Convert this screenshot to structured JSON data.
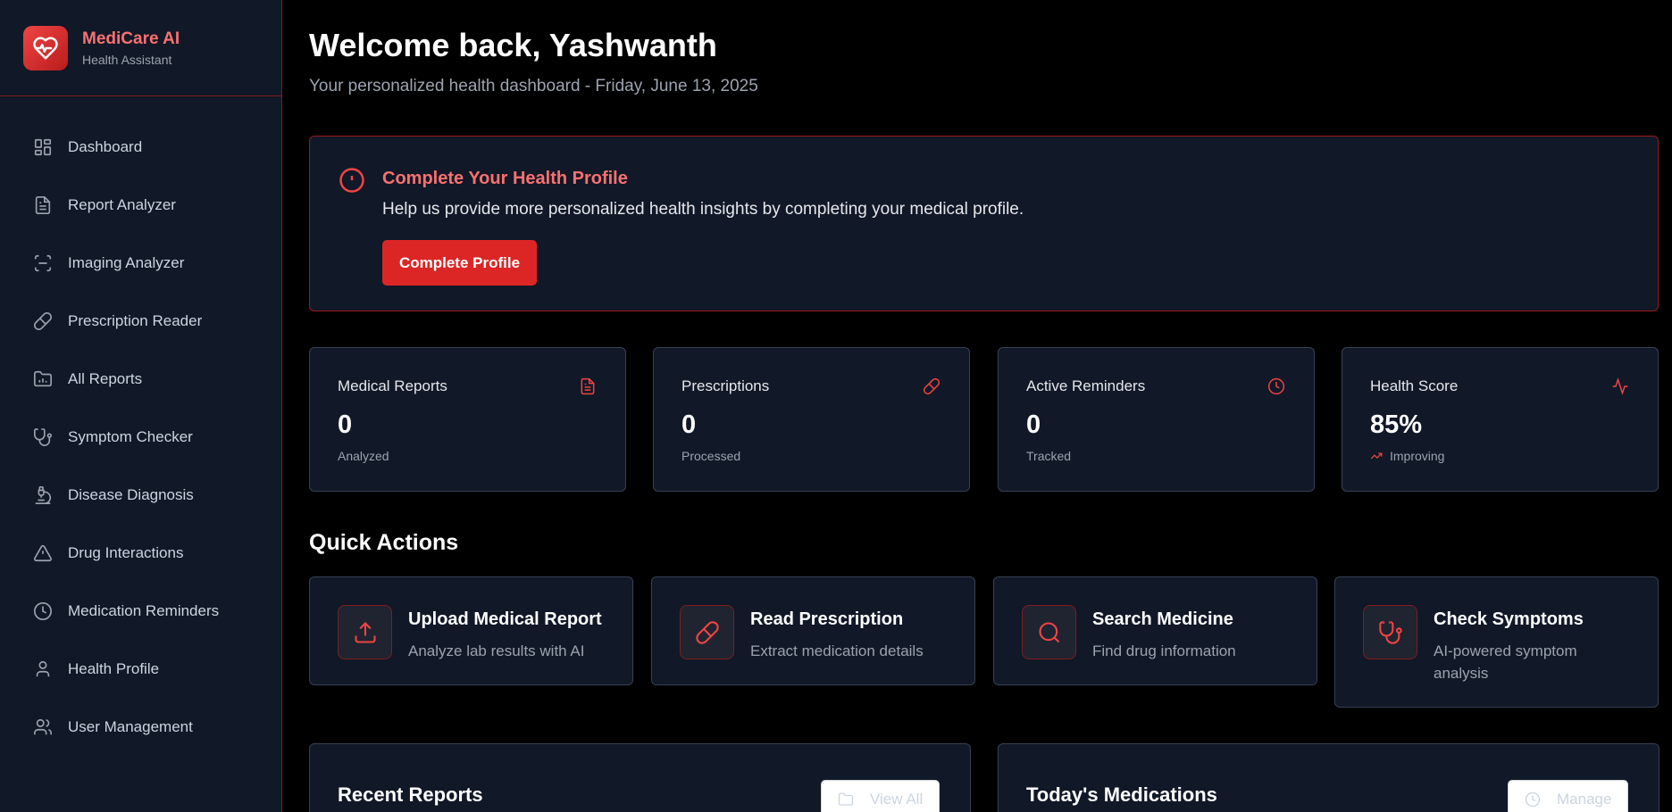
{
  "brand": {
    "name": "MediCare AI",
    "subtitle": "Health Assistant"
  },
  "sidebar": {
    "items": [
      {
        "label": "Dashboard",
        "icon": "grid-icon"
      },
      {
        "label": "Report Analyzer",
        "icon": "file-text-icon"
      },
      {
        "label": "Imaging Analyzer",
        "icon": "scan-icon"
      },
      {
        "label": "Prescription Reader",
        "icon": "pill-icon"
      },
      {
        "label": "All Reports",
        "icon": "folder-chart-icon"
      },
      {
        "label": "Symptom Checker",
        "icon": "stethoscope-icon"
      },
      {
        "label": "Disease Diagnosis",
        "icon": "microscope-icon"
      },
      {
        "label": "Drug Interactions",
        "icon": "warning-icon"
      },
      {
        "label": "Medication Reminders",
        "icon": "clock-icon"
      },
      {
        "label": "Health Profile",
        "icon": "user-icon"
      },
      {
        "label": "User Management",
        "icon": "users-icon"
      }
    ]
  },
  "header": {
    "welcome": "Welcome back, Yashwanth",
    "subtitle": "Your personalized health dashboard - Friday, June 13, 2025"
  },
  "alert": {
    "title": "Complete Your Health Profile",
    "text": "Help us provide more personalized health insights by completing your medical profile.",
    "button": "Complete Profile",
    "icon": "alert-circle-icon"
  },
  "stats": [
    {
      "label": "Medical Reports",
      "value": "0",
      "sub": "Analyzed",
      "icon": "file-text-icon"
    },
    {
      "label": "Prescriptions",
      "value": "0",
      "sub": "Processed",
      "icon": "pill-icon"
    },
    {
      "label": "Active Reminders",
      "value": "0",
      "sub": "Tracked",
      "icon": "clock-icon"
    },
    {
      "label": "Health Score",
      "value": "85%",
      "sub": "Improving",
      "icon": "activity-icon",
      "sub_icon": "trending-up-icon"
    }
  ],
  "quick_actions": {
    "title": "Quick Actions",
    "items": [
      {
        "title": "Upload Medical Report",
        "desc": "Analyze lab results with AI",
        "icon": "upload-icon"
      },
      {
        "title": "Read Prescription",
        "desc": "Extract medication details",
        "icon": "pill-icon"
      },
      {
        "title": "Search Medicine",
        "desc": "Find drug information",
        "icon": "search-icon"
      },
      {
        "title": "Check Symptoms",
        "desc": "AI-powered symptom analysis",
        "icon": "stethoscope-icon"
      }
    ]
  },
  "panels": {
    "recent_reports": {
      "title": "Recent Reports",
      "button": "View All"
    },
    "todays_medications": {
      "title": "Today's Medications",
      "button": "Manage"
    }
  },
  "colors": {
    "accent": "#dc2626",
    "accent_text": "#f87171",
    "sidebar_bg": "#111827",
    "card_bg": "#111827",
    "page_bg": "#000000"
  }
}
